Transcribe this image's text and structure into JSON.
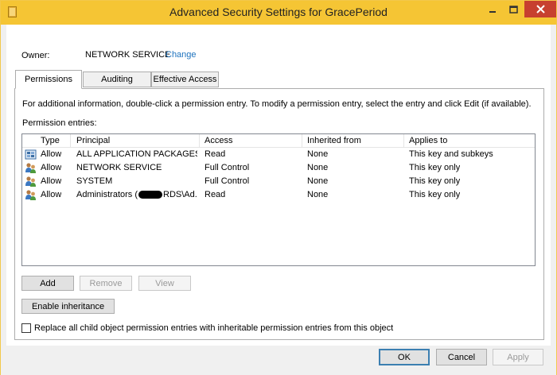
{
  "window": {
    "title": "Advanced Security Settings for GracePeriod"
  },
  "owner": {
    "label": "Owner:",
    "value": "NETWORK SERVICE",
    "change_link": "Change"
  },
  "tabs": [
    {
      "label": "Permissions",
      "active": true
    },
    {
      "label": "Auditing",
      "active": false
    },
    {
      "label": "Effective Access",
      "active": false
    }
  ],
  "permissions": {
    "info_text": "For additional information, double-click a permission entry. To modify a permission entry, select the entry and click Edit (if available).",
    "entries_label": "Permission entries:",
    "columns": [
      "Type",
      "Principal",
      "Access",
      "Inherited from",
      "Applies to"
    ],
    "rows": [
      {
        "icon": "package-group-icon",
        "type": "Allow",
        "principal": "ALL APPLICATION PACKAGES",
        "access": "Read",
        "inherited": "None",
        "applies": "This key and subkeys"
      },
      {
        "icon": "users-icon",
        "type": "Allow",
        "principal": "NETWORK SERVICE",
        "access": "Full Control",
        "inherited": "None",
        "applies": "This key only"
      },
      {
        "icon": "users-icon",
        "type": "Allow",
        "principal": "SYSTEM",
        "access": "Full Control",
        "inherited": "None",
        "applies": "This key only"
      },
      {
        "icon": "users-icon",
        "type": "Allow",
        "principal_prefix": "Administrators (",
        "principal_suffix": "RDS\\Ad...",
        "access": "Read",
        "inherited": "None",
        "applies": "This key only"
      }
    ]
  },
  "buttons": {
    "add": "Add",
    "remove": "Remove",
    "view": "View",
    "enable_inheritance": "Enable inheritance",
    "ok": "OK",
    "cancel": "Cancel",
    "apply": "Apply"
  },
  "replace_checkbox": {
    "label": "Replace all child object permission entries with inheritable permission entries from this object",
    "checked": false
  },
  "colors": {
    "titlebar": "#f5c534",
    "close_button": "#c7402f",
    "link": "#1e73be"
  }
}
